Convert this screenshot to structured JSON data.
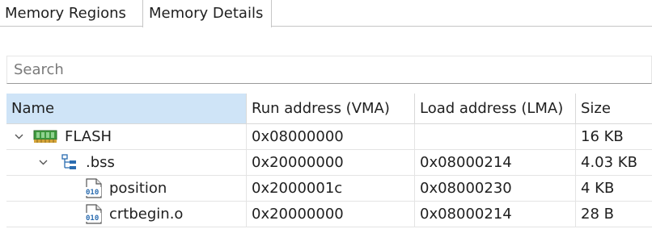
{
  "tabs": [
    {
      "label": "Memory Regions",
      "active": false
    },
    {
      "label": "Memory Details",
      "active": true
    }
  ],
  "search": {
    "placeholder": "Search",
    "value": ""
  },
  "table": {
    "columns": [
      "Name",
      "Run address (VMA)",
      "Load address (LMA)",
      "Size"
    ],
    "rows": [
      {
        "name": "FLASH",
        "vma": "0x08000000",
        "lma": "",
        "size": "16 KB",
        "icon": "memory-chip-icon",
        "expanded": true,
        "depth": 0
      },
      {
        "name": ".bss",
        "vma": "0x20000000",
        "lma": "0x08000214",
        "size": "4.03 KB",
        "icon": "section-tree-icon",
        "expanded": true,
        "depth": 1
      },
      {
        "name": "position",
        "vma": "0x2000001c",
        "lma": "0x08000230",
        "size": "4 KB",
        "icon": "binary-file-icon",
        "depth": 2
      },
      {
        "name": "crtbegin.o",
        "vma": "0x20000000",
        "lma": "0x08000214",
        "size": "28 B",
        "icon": "binary-file-icon",
        "depth": 2
      }
    ]
  },
  "colors": {
    "header_selected": "#cfe4f7",
    "chip_green": "#3f9b3f",
    "icon_blue": "#2b6cb0"
  }
}
